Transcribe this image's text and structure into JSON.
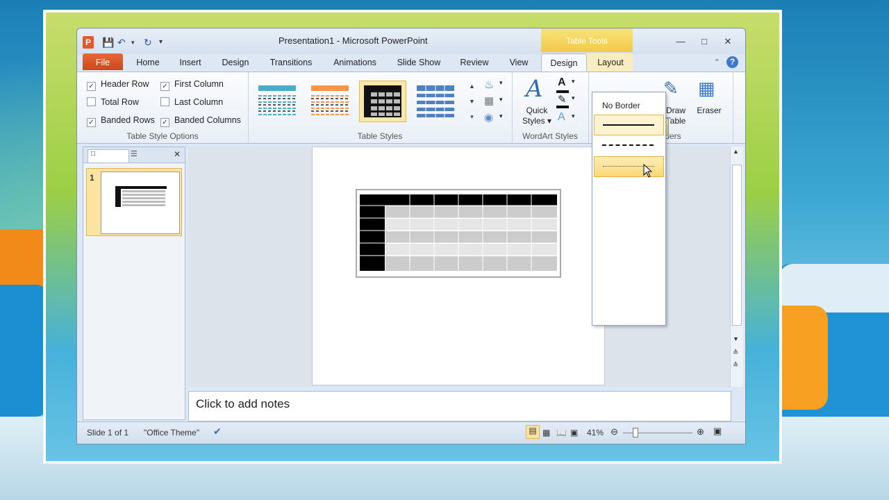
{
  "window": {
    "title": "Presentation1  -  Microsoft PowerPoint",
    "context_tab": "Table Tools"
  },
  "tabs": [
    {
      "label": "File"
    },
    {
      "label": "Home"
    },
    {
      "label": "Insert"
    },
    {
      "label": "Design"
    },
    {
      "label": "Transitions"
    },
    {
      "label": "Animations"
    },
    {
      "label": "Slide Show"
    },
    {
      "label": "Review"
    },
    {
      "label": "View"
    },
    {
      "label": "Design"
    },
    {
      "label": "Layout"
    }
  ],
  "table_style_options": {
    "group_label": "Table Style Options",
    "options": [
      {
        "label": "Header Row",
        "checked": true
      },
      {
        "label": "First Column",
        "checked": true
      },
      {
        "label": "Total Row",
        "checked": false
      },
      {
        "label": "Last Column",
        "checked": false
      },
      {
        "label": "Banded Rows",
        "checked": true
      },
      {
        "label": "Banded Columns",
        "checked": true
      }
    ]
  },
  "table_styles": {
    "group_label": "Table Styles",
    "swatches": [
      {
        "name": "blue-style",
        "color": "#4bacc6"
      },
      {
        "name": "orange-style",
        "color": "#f79646"
      },
      {
        "name": "black-style",
        "color": "#000000",
        "selected": true
      },
      {
        "name": "blue-grey-style",
        "color": "#4f81bd"
      }
    ]
  },
  "wordart": {
    "group_label": "WordArt Styles",
    "quick_styles_label": "Quick Styles"
  },
  "draw_borders": {
    "group_label": "rders",
    "draw_table_label": "Draw Table",
    "eraser_label": "Eraser"
  },
  "border_menu": {
    "no_border_label": "No Border",
    "styles": [
      "solid-selected",
      "dashed",
      "dotted-hover",
      "dash-dot-short",
      "dash-dot-dot",
      "sparse-dot",
      "dash",
      "long-dash-dot",
      "long-dash-dot-dot",
      "long-dash-dot-long"
    ]
  },
  "slides_panel": {
    "slide_number": "1"
  },
  "notes": {
    "placeholder": "Click to add notes"
  },
  "status_bar": {
    "slide_info": "Slide 1 of 1",
    "theme": "\"Office Theme\"",
    "zoom": "41%"
  },
  "colors": {
    "accent_file": "#d9552a",
    "selection": "#f9d877",
    "context_tab": "#f2c94a"
  }
}
